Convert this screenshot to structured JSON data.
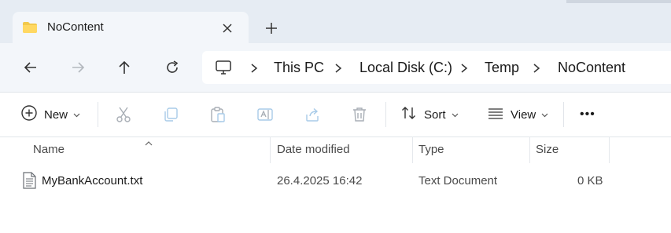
{
  "tab": {
    "title": "NoContent"
  },
  "address": {
    "crumbs": [
      "This PC",
      "Local Disk (C:)",
      "Temp",
      "NoContent"
    ]
  },
  "toolbar": {
    "new_label": "New",
    "sort_label": "Sort",
    "view_label": "View",
    "more_label": "•••"
  },
  "columns": {
    "name": "Name",
    "date": "Date modified",
    "type": "Type",
    "size": "Size"
  },
  "files": [
    {
      "name": "MyBankAccount.txt",
      "date": "26.4.2025 16:42",
      "type": "Text Document",
      "size": "0 KB"
    }
  ]
}
